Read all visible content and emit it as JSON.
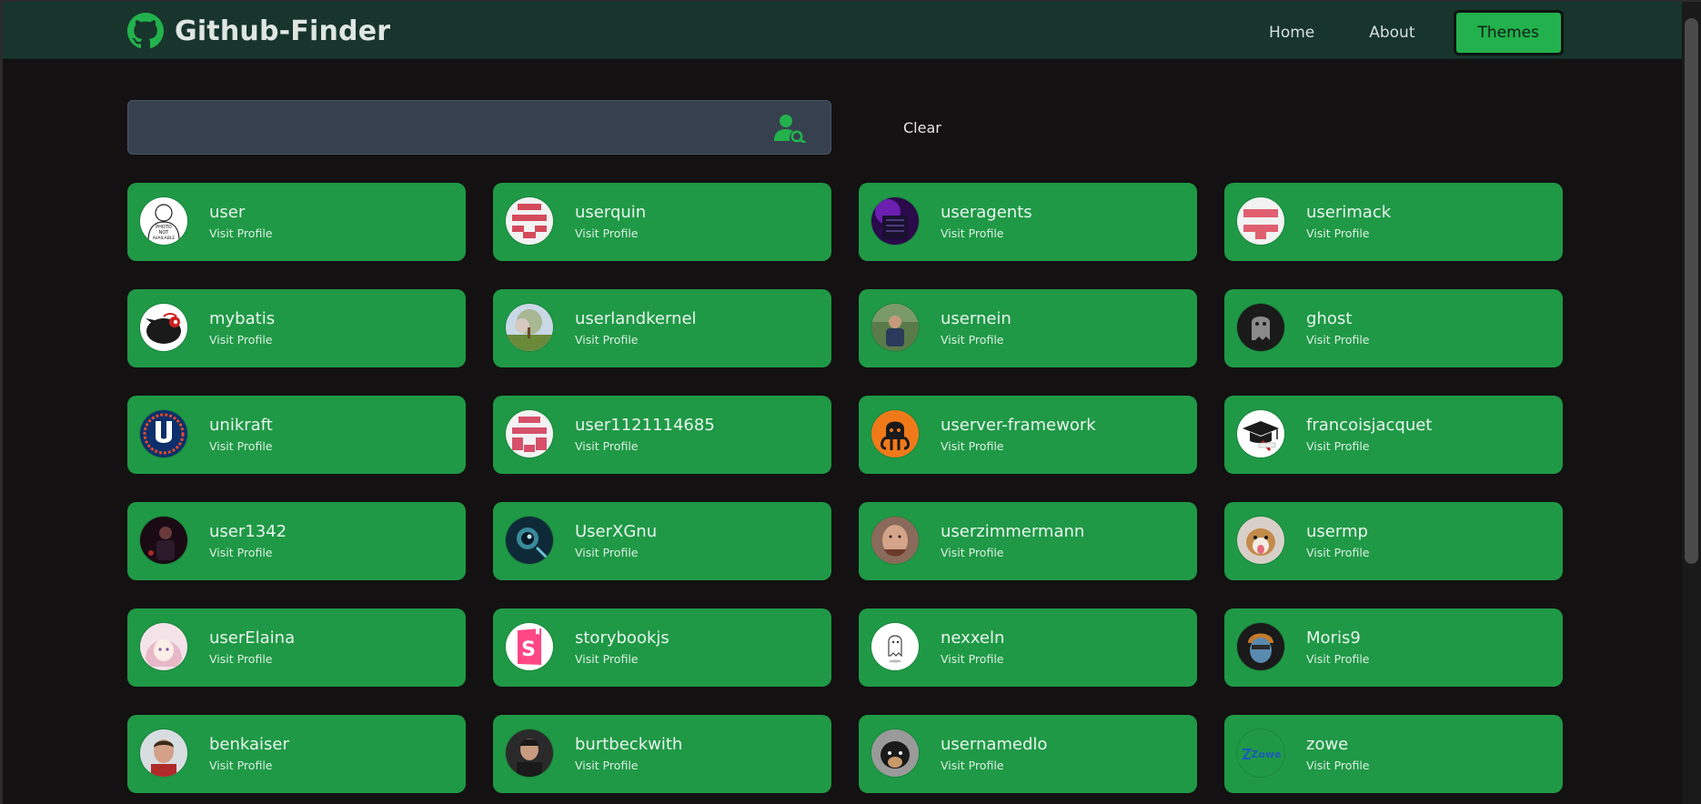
{
  "app": {
    "title": "Github-Finder"
  },
  "nav": {
    "home": "Home",
    "about": "About",
    "themes": "Themes"
  },
  "search": {
    "value": "",
    "placeholder": "",
    "clear_label": "Clear"
  },
  "colors": {
    "navbar_bg": "#17352c",
    "page_bg": "#131111",
    "card_bg": "#1f9946",
    "accent": "#22b14c",
    "search_bg": "#36404f"
  },
  "users": [
    {
      "name": "user",
      "link": "Visit Profile",
      "avatar": "photo-not-available-icon"
    },
    {
      "name": "userquin",
      "link": "Visit Profile",
      "avatar": "identicon-red-icon"
    },
    {
      "name": "useragents",
      "link": "Visit Profile",
      "avatar": "purple-photo-avatar"
    },
    {
      "name": "userimack",
      "link": "Visit Profile",
      "avatar": "identicon-red-icon"
    },
    {
      "name": "mybatis",
      "link": "Visit Profile",
      "avatar": "bird-logo-avatar"
    },
    {
      "name": "userlandkernel",
      "link": "Visit Profile",
      "avatar": "tree-photo-avatar"
    },
    {
      "name": "usernein",
      "link": "Visit Profile",
      "avatar": "person-photo-avatar"
    },
    {
      "name": "ghost",
      "link": "Visit Profile",
      "avatar": "ghost-avatar"
    },
    {
      "name": "unikraft",
      "link": "Visit Profile",
      "avatar": "unikraft-logo-avatar"
    },
    {
      "name": "user1121114685",
      "link": "Visit Profile",
      "avatar": "identicon-pink-icon"
    },
    {
      "name": "userver-framework",
      "link": "Visit Profile",
      "avatar": "octopus-logo-avatar"
    },
    {
      "name": "francoisjacquet",
      "link": "Visit Profile",
      "avatar": "graduation-cap-avatar"
    },
    {
      "name": "user1342",
      "link": "Visit Profile",
      "avatar": "dark-photo-avatar"
    },
    {
      "name": "UserXGnu",
      "link": "Visit Profile",
      "avatar": "teal-art-avatar"
    },
    {
      "name": "userzimmermann",
      "link": "Visit Profile",
      "avatar": "face-photo-avatar"
    },
    {
      "name": "usermp",
      "link": "Visit Profile",
      "avatar": "dog-photo-avatar"
    },
    {
      "name": "userElaina",
      "link": "Visit Profile",
      "avatar": "anime-art-avatar"
    },
    {
      "name": "storybookjs",
      "link": "Visit Profile",
      "avatar": "storybook-logo-avatar"
    },
    {
      "name": "nexxeln",
      "link": "Visit Profile",
      "avatar": "sketch-ghost-avatar"
    },
    {
      "name": "Moris9",
      "link": "Visit Profile",
      "avatar": "portrait-art-avatar"
    },
    {
      "name": "benkaiser",
      "link": "Visit Profile",
      "avatar": "man-photo-avatar"
    },
    {
      "name": "burtbeckwith",
      "link": "Visit Profile",
      "avatar": "man-photo-avatar"
    },
    {
      "name": "usernamedlo",
      "link": "Visit Profile",
      "avatar": "dog-face-avatar"
    },
    {
      "name": "zowe",
      "link": "Visit Profile",
      "avatar": "zowe-logo-avatar"
    }
  ],
  "zowe_logo_text": "Zowe",
  "placeholder_avatar_text": [
    "PHOTO",
    "NOT",
    "AVAILABLE"
  ]
}
